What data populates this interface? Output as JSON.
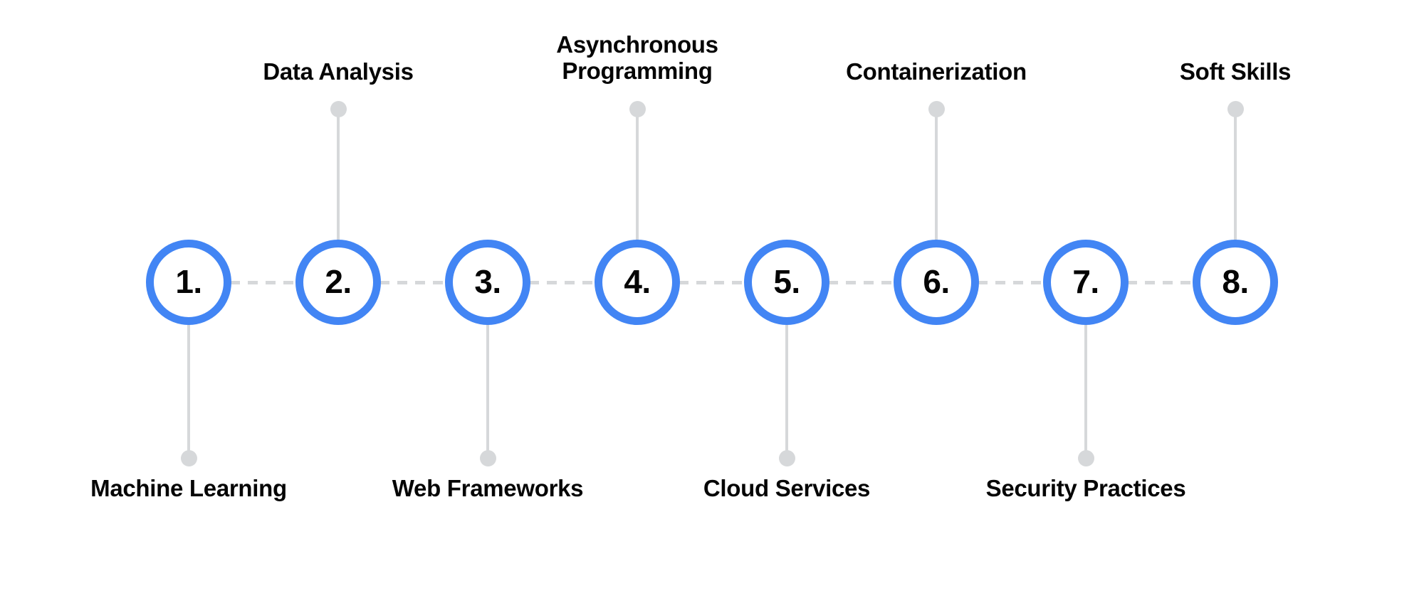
{
  "diagram": {
    "type": "numbered-roadmap-timeline",
    "accent_color": "#4285f4",
    "connector_color": "#d6d8da",
    "text_color": "#050505",
    "background_color": "#ffffff",
    "step_count": 8
  },
  "steps": [
    {
      "number": "1.",
      "label": "Machine Learning",
      "position": "below"
    },
    {
      "number": "2.",
      "label": "Data Analysis",
      "position": "above"
    },
    {
      "number": "3.",
      "label": "Web Frameworks",
      "position": "below"
    },
    {
      "number": "4.",
      "label": "Asynchronous\nProgramming",
      "position": "above"
    },
    {
      "number": "5.",
      "label": "Cloud Services",
      "position": "below"
    },
    {
      "number": "6.",
      "label": "Containerization",
      "position": "above"
    },
    {
      "number": "7.",
      "label": "Security Practices",
      "position": "below"
    },
    {
      "number": "8.",
      "label": "Soft Skills",
      "position": "above"
    }
  ]
}
